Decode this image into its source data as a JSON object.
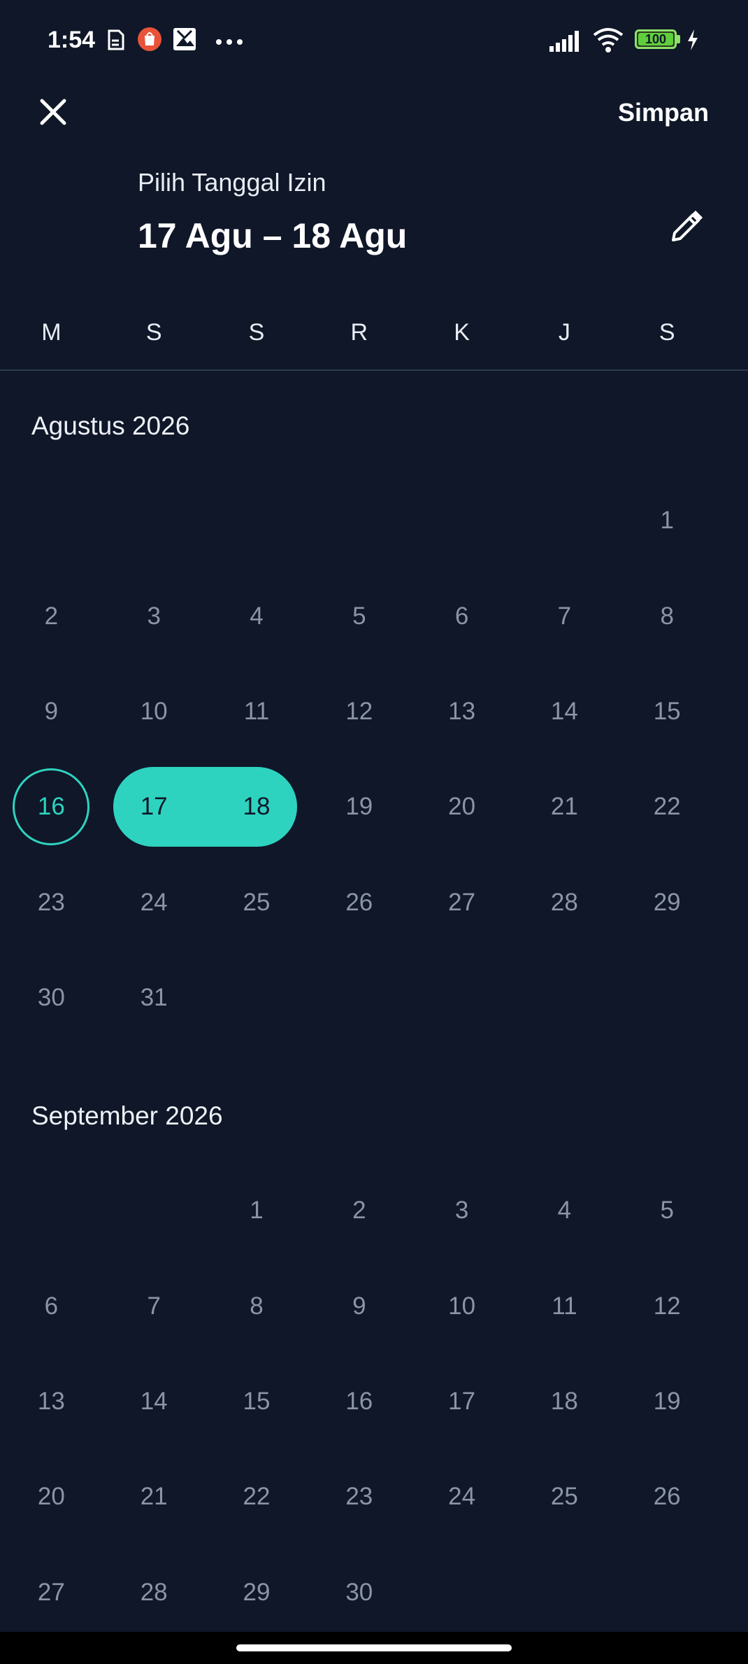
{
  "status_bar": {
    "time": "1:54",
    "battery": "100",
    "icons": [
      "sim-card-icon",
      "shopee-bag-icon",
      "photo-icon",
      "more-dots-icon",
      "signal-icon",
      "wifi-icon",
      "battery-icon",
      "charging-icon"
    ]
  },
  "header": {
    "close_icon": "close-icon",
    "save_label": "Simpan",
    "subtitle": "Pilih Tanggal Izin",
    "range_label": "17 Agu – 18 Agu",
    "edit_icon": "pencil-icon"
  },
  "weekdays": [
    "M",
    "S",
    "S",
    "R",
    "K",
    "J",
    "S"
  ],
  "colors": {
    "background": "#0f1728",
    "accent": "#2ed3c0",
    "day_text": "#8b95a6"
  },
  "months": [
    {
      "title": "Agustus 2026",
      "start_weekday_index": 6,
      "days_in_month": 31,
      "today": 16,
      "range_start": 17,
      "range_end": 18
    },
    {
      "title": "September 2026",
      "start_weekday_index": 2,
      "days_in_month": 30,
      "today": null,
      "range_start": null,
      "range_end": null
    }
  ]
}
